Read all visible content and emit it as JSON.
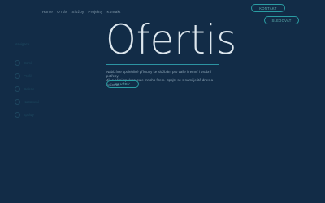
{
  "nav": {
    "items": [
      "Home",
      "O nás",
      "Služby",
      "Projekty",
      "Kontakt"
    ]
  },
  "header": {
    "contact_button": "Kontakt",
    "follow_button": "Sledovat"
  },
  "sidebar": {
    "title": "Navigace",
    "items": [
      {
        "label": "Domů",
        "icon": "home-icon"
      },
      {
        "label": "Profil",
        "icon": "user-icon"
      },
      {
        "label": "Galerie",
        "icon": "image-icon"
      },
      {
        "label": "Nastavení",
        "icon": "gear-icon"
      },
      {
        "label": "Zprávy",
        "icon": "mail-icon"
      }
    ]
  },
  "hero": {
    "title": "Ofertis",
    "line1": "Nabízíme spolehlivé přístupy ke službám pro vaše firemní i osobní potřeby.",
    "line2": "Již s námi spolupracuje mnoho firem. Spojte se s námi ještě dnes a začněte.",
    "button": "Služby"
  },
  "colors": {
    "background": "#122c47",
    "accent": "#2a9da3",
    "title": "#dde7ee"
  }
}
